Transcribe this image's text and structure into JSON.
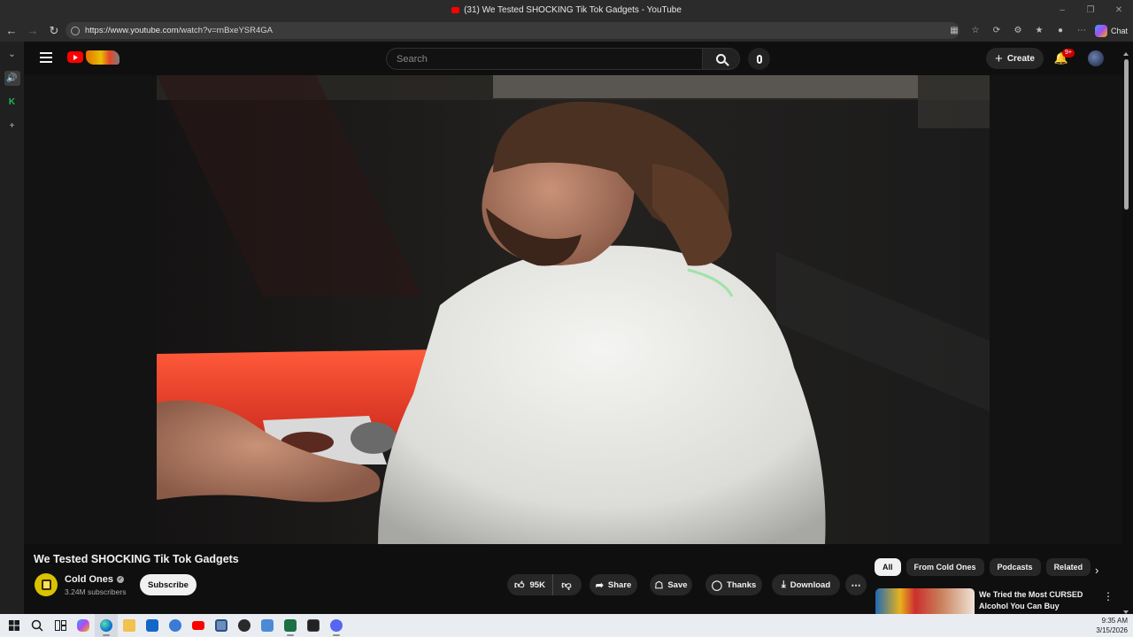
{
  "browser": {
    "window_title": "(31) We Tested SHOCKING Tik Tok Gadgets - YouTube",
    "url_host": "https://www.youtube.com",
    "url_path": "/watch?v=rnBxeYSR4GA",
    "chat_label": "Chat"
  },
  "youtube": {
    "search_placeholder": "Search",
    "create_label": "Create",
    "notification_count": "9+",
    "video": {
      "title": "We Tested SHOCKING Tik Tok Gadgets",
      "channel_name": "Cold Ones",
      "subscriber_count": "3.24M subscribers",
      "subscribe_label": "Subscribe",
      "like_count": "95K",
      "share_label": "Share",
      "save_label": "Save",
      "thanks_label": "Thanks",
      "download_label": "Download"
    },
    "chips": [
      "All",
      "From Cold Ones",
      "Podcasts",
      "Related"
    ],
    "recommended": [
      {
        "title": "We Tried the Most CURSED Alcohol You Can Buy"
      }
    ]
  },
  "taskbar": {
    "time": "9:35 AM",
    "date": "3/15/2026"
  },
  "colors": {
    "youtube_red": "#ff0000",
    "page_bg": "#0f0f0f",
    "chip_bg": "#272727",
    "accent_text": "#f1f1f1"
  }
}
